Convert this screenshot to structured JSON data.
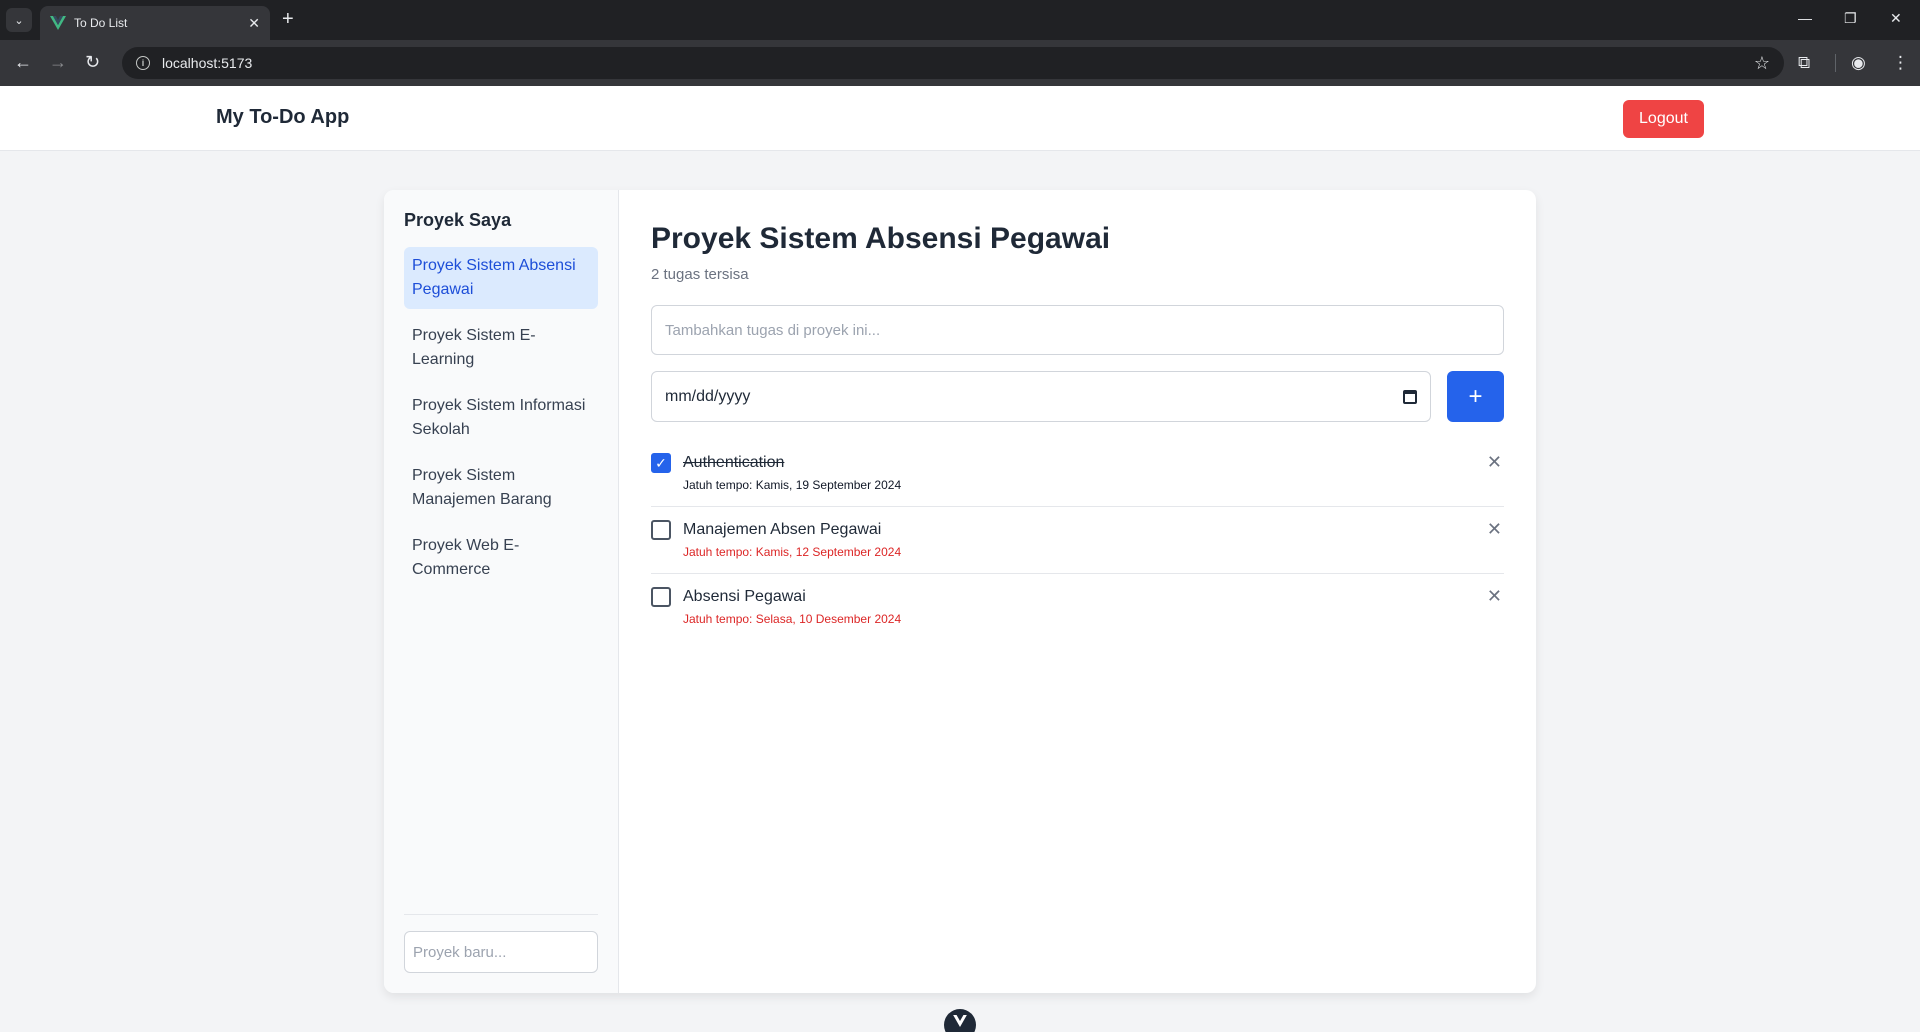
{
  "browser": {
    "tab_title": "To Do List",
    "url": "localhost:5173"
  },
  "header": {
    "app_title": "My To-Do App",
    "logout_label": "Logout"
  },
  "sidebar": {
    "title": "Proyek Saya",
    "items": [
      {
        "label": "Proyek Sistem Absensi Pegawai",
        "active": true
      },
      {
        "label": "Proyek Sistem E-Learning",
        "active": false
      },
      {
        "label": "Proyek Sistem Informasi Sekolah",
        "active": false
      },
      {
        "label": "Proyek Sistem Manajemen Barang",
        "active": false
      },
      {
        "label": "Proyek Web E-Commerce",
        "active": false
      }
    ],
    "new_project_placeholder": "Proyek baru..."
  },
  "main": {
    "project_title": "Proyek Sistem Absensi Pegawai",
    "task_count": "2 tugas tersisa",
    "task_input_placeholder": "Tambahkan tugas di proyek ini...",
    "date_placeholder": "mm/dd/yyyy",
    "add_label": "+",
    "tasks": [
      {
        "name": "Authentication",
        "due": "Jatuh tempo: Kamis, 19 September 2024",
        "done": true,
        "overdue": false
      },
      {
        "name": "Manajemen Absen Pegawai",
        "due": "Jatuh tempo: Kamis, 12 September 2024",
        "done": false,
        "overdue": true
      },
      {
        "name": "Absensi Pegawai",
        "due": "Jatuh tempo: Selasa, 10 Desember 2024",
        "done": false,
        "overdue": true
      }
    ]
  },
  "icons": {
    "delete": "close-icon",
    "checkmark": "check-icon",
    "calendar": "calendar-icon"
  },
  "colors": {
    "accent": "#2563eb",
    "danger": "#ef4444",
    "overdue": "#dc2626",
    "active_bg": "#dbeafe"
  }
}
